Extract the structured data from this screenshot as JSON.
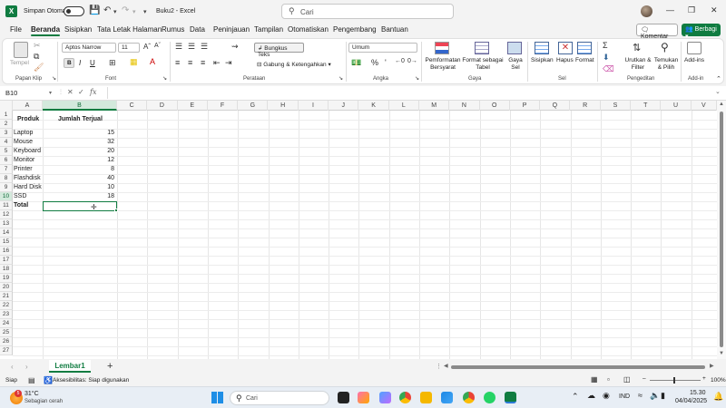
{
  "titlebar": {
    "app_icon": "excel-icon",
    "autosave_label": "Simpan Otomatis",
    "document_title": "Buku2 - Excel",
    "search_placeholder": "Cari"
  },
  "menu": {
    "tabs": [
      "File",
      "Beranda",
      "Sisipkan",
      "Tata Letak Halaman",
      "Rumus",
      "Data",
      "Peninjauan",
      "Tampilan",
      "Otomatiskan",
      "Pengembang",
      "Bantuan"
    ],
    "active_tab": "Beranda",
    "comment_label": "Komentar",
    "share_label": "Berbagi"
  },
  "ribbon": {
    "clipboard": {
      "paste_label": "Tempel",
      "group_label": "Papan Klip"
    },
    "font": {
      "name": "Aptos Narrow",
      "size": "11",
      "group_label": "Font",
      "bold": "B",
      "italic": "I",
      "underline": "U"
    },
    "alignment": {
      "wrap_text": "Bungkus Teks",
      "merge_center": "Gabung & Ketengahkan",
      "group_label": "Perataan"
    },
    "number": {
      "format": "Umum",
      "group_label": "Angka"
    },
    "styles": {
      "conditional_formatting": "Pemformatan Bersyarat",
      "format_as_table": "Format sebagai Tabel",
      "cell_styles": "Gaya Sel",
      "group_label": "Gaya"
    },
    "cells": {
      "insert": "Sisipkan",
      "delete": "Hapus",
      "format": "Format",
      "group_label": "Sel"
    },
    "editing": {
      "sort_filter": "Urutkan & Filter",
      "find_select": "Temukan & Pilih",
      "group_label": "Pengeditan"
    },
    "addins": {
      "label": "Add-ins",
      "group_label": "Add-in"
    }
  },
  "formula_bar": {
    "name_box": "B10",
    "fx_label": "fx",
    "content": ""
  },
  "sheet": {
    "columns": [
      "A",
      "B",
      "C",
      "D",
      "E",
      "F",
      "G",
      "H",
      "I",
      "J",
      "K",
      "L",
      "M",
      "N",
      "O",
      "P",
      "Q",
      "R",
      "S",
      "T",
      "U",
      "V"
    ],
    "row_count": 27,
    "selected_cell": "B10",
    "headers": {
      "produk": "Produk",
      "jumlah": "Jumlah Terjual"
    },
    "rows": [
      {
        "produk": "Laptop",
        "jumlah": "15"
      },
      {
        "produk": "Mouse",
        "jumlah": "32"
      },
      {
        "produk": "Keyboard",
        "jumlah": "20"
      },
      {
        "produk": "Monitor",
        "jumlah": "12"
      },
      {
        "produk": "Printer",
        "jumlah": "8"
      },
      {
        "produk": "Flashdisk",
        "jumlah": "40"
      },
      {
        "produk": "Hard Disk",
        "jumlah": "10"
      },
      {
        "produk": "SSD",
        "jumlah": "18"
      }
    ],
    "total_label": "Total"
  },
  "sheet_tabs": {
    "active": "Lembar1",
    "add_icon": "plus-icon"
  },
  "status": {
    "mode": "Siap",
    "accessibility": "Aksesibilitas: Siap digunakan",
    "zoom": "100%"
  },
  "taskbar": {
    "weather_temp": "31°C",
    "weather_desc": "Sebagian cerah",
    "search_placeholder": "Cari",
    "language": "IND",
    "time": "15.30",
    "date": "04/04/2025",
    "badge_count": "5"
  }
}
